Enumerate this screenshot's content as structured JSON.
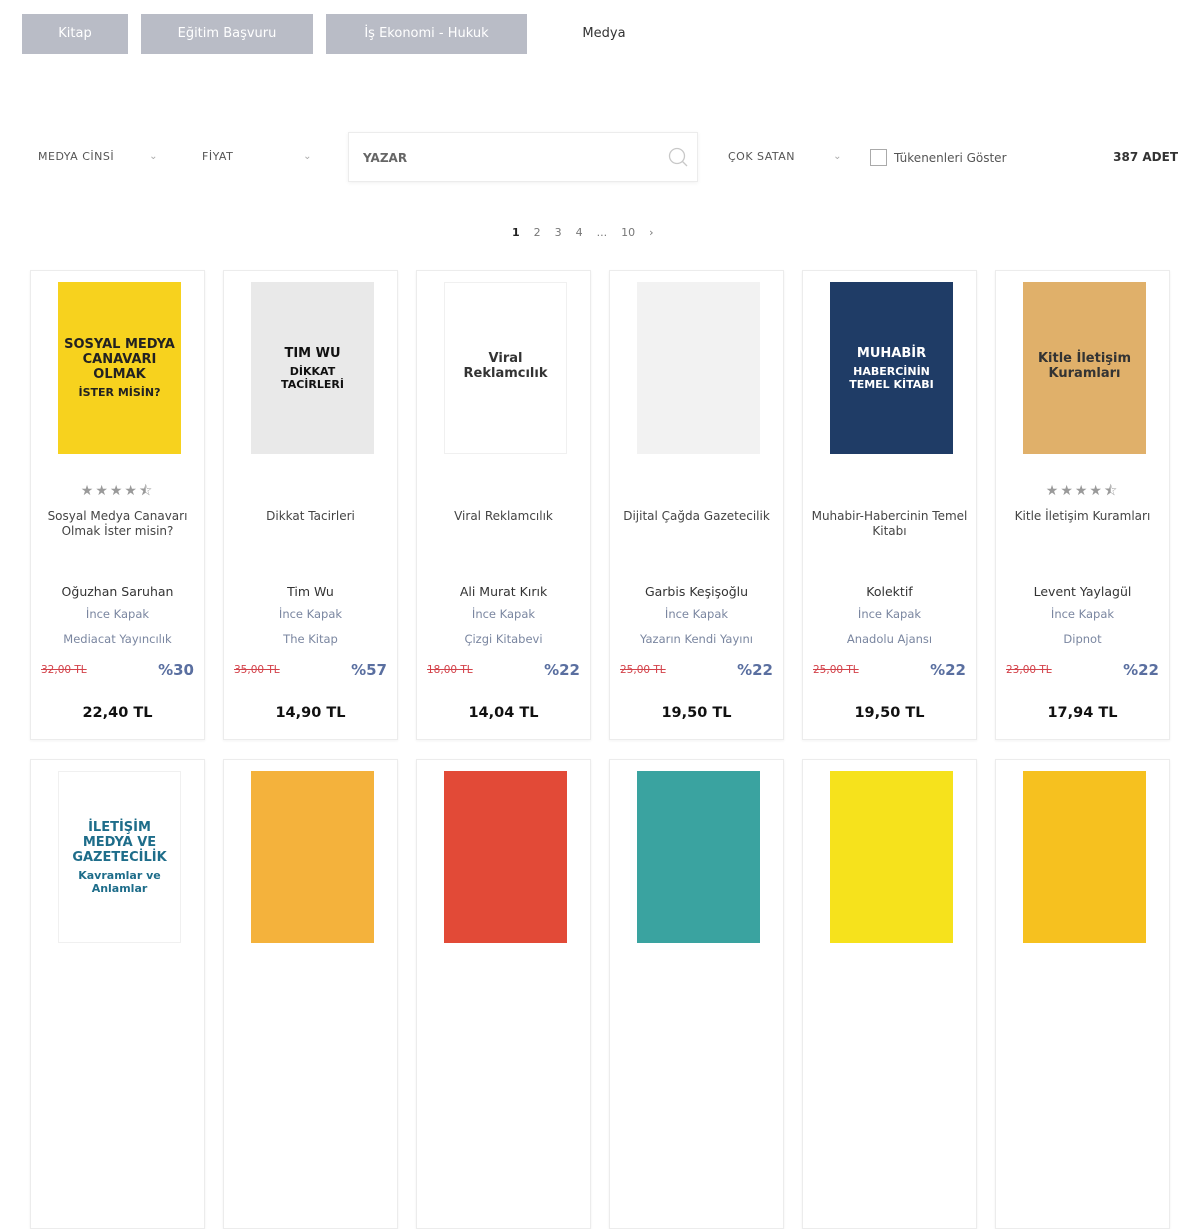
{
  "tabs": [
    {
      "label": "Kitap",
      "active": false
    },
    {
      "label": "Eğitim Başvuru",
      "active": false
    },
    {
      "label": "İş Ekonomi - Hukuk",
      "active": false
    },
    {
      "label": "Medya",
      "active": true
    }
  ],
  "filters": {
    "media_type": "MEDYA CİNSİ",
    "price": "FİYAT",
    "author_placeholder": "YAZAR",
    "sort": "ÇOK SATAN",
    "show_out_of_stock": "Tükenenleri Göster",
    "count": "387 ADET"
  },
  "pagination": {
    "pages": [
      "1",
      "2",
      "3",
      "4",
      "...",
      "10"
    ],
    "current": "1",
    "next": "›"
  },
  "products": [
    {
      "title": "Sosyal Medya Canavarı Olmak İster misin?",
      "author": "Oğuzhan Saruhan",
      "binding": "İnce Kapak",
      "publisher": "Mediacat Yayıncılık",
      "old_price": "32,00 TL",
      "discount": "%30",
      "price": "22,40 TL",
      "rating": 4.5,
      "cover_color": "#f7d21e",
      "cover_text": "SOSYAL MEDYA CANAVARI OLMAK",
      "cover_sub": "İSTER MİSİN?",
      "cover_text_color": "#222222"
    },
    {
      "title": "Dikkat Tacirleri",
      "author": "Tim Wu",
      "binding": "İnce Kapak",
      "publisher": "The Kitap",
      "old_price": "35,00 TL",
      "discount": "%57",
      "price": "14,90 TL",
      "rating": null,
      "cover_color": "#e9e9e9",
      "cover_text": "TIM WU",
      "cover_sub": "DİKKAT TACİRLERİ",
      "cover_text_color": "#111111"
    },
    {
      "title": "Viral Reklamcılık",
      "author": "Ali Murat Kırık",
      "binding": "İnce Kapak",
      "publisher": "Çizgi Kitabevi",
      "old_price": "18,00 TL",
      "discount": "%22",
      "price": "14,04 TL",
      "rating": null,
      "cover_color": "#ffffff",
      "cover_text": "Viral Reklamcılık",
      "cover_sub": "",
      "cover_text_color": "#333333"
    },
    {
      "title": "Dijital Çağda Gazetecilik",
      "author": "Garbis Keşişoğlu",
      "binding": "İnce Kapak",
      "publisher": "Yazarın Kendi Yayını",
      "old_price": "25,00 TL",
      "discount": "%22",
      "price": "19,50 TL",
      "rating": null,
      "cover_color": "#f2f2f2",
      "cover_text": "",
      "cover_sub": "",
      "cover_text_color": "#333333"
    },
    {
      "title": "Muhabir-Habercinin Temel Kitabı",
      "author": "Kolektif",
      "binding": "İnce Kapak",
      "publisher": "Anadolu Ajansı",
      "old_price": "25,00 TL",
      "discount": "%22",
      "price": "19,50 TL",
      "rating": null,
      "cover_color": "#1f3c66",
      "cover_text": "MUHABİR",
      "cover_sub": "HABERCİNİN TEMEL KİTABI",
      "cover_text_color": "#ffffff"
    },
    {
      "title": "Kitle İletişim Kuramları",
      "author": "Levent Yaylagül",
      "binding": "İnce Kapak",
      "publisher": "Dipnot",
      "old_price": "23,00 TL",
      "discount": "%22",
      "price": "17,94 TL",
      "rating": 4.5,
      "cover_color": "#e0b06a",
      "cover_text": "Kitle İletişim Kuramları",
      "cover_sub": "",
      "cover_text_color": "#333333"
    },
    {
      "title": "",
      "author": "",
      "binding": "",
      "publisher": "",
      "old_price": "",
      "discount": "",
      "price": "",
      "rating": null,
      "cover_color": "#ffffff",
      "cover_text": "İLETİŞİM MEDYA VE GAZETECİLİK",
      "cover_sub": "Kavramlar ve Anlamlar",
      "cover_text_color": "#1e6d8a"
    },
    {
      "title": "",
      "author": "",
      "binding": "",
      "publisher": "",
      "old_price": "",
      "discount": "",
      "price": "",
      "rating": null,
      "cover_color": "#f4b23c",
      "cover_text": "",
      "cover_sub": "",
      "cover_text_color": "#222222"
    },
    {
      "title": "",
      "author": "",
      "binding": "",
      "publisher": "",
      "old_price": "",
      "discount": "",
      "price": "",
      "rating": null,
      "cover_color": "#e24a37",
      "cover_text": "",
      "cover_sub": "",
      "cover_text_color": "#ffffff"
    },
    {
      "title": "",
      "author": "",
      "binding": "",
      "publisher": "",
      "old_price": "",
      "discount": "",
      "price": "",
      "rating": null,
      "cover_color": "#3aa3a0",
      "cover_text": "",
      "cover_sub": "",
      "cover_text_color": "#ffffff"
    },
    {
      "title": "",
      "author": "",
      "binding": "",
      "publisher": "",
      "old_price": "",
      "discount": "",
      "price": "",
      "rating": null,
      "cover_color": "#f6e21c",
      "cover_text": "",
      "cover_sub": "",
      "cover_text_color": "#222222"
    },
    {
      "title": "",
      "author": "",
      "binding": "",
      "publisher": "",
      "old_price": "",
      "discount": "",
      "price": "",
      "rating": null,
      "cover_color": "#f6c11f",
      "cover_text": "",
      "cover_sub": "",
      "cover_text_color": "#222222"
    }
  ]
}
